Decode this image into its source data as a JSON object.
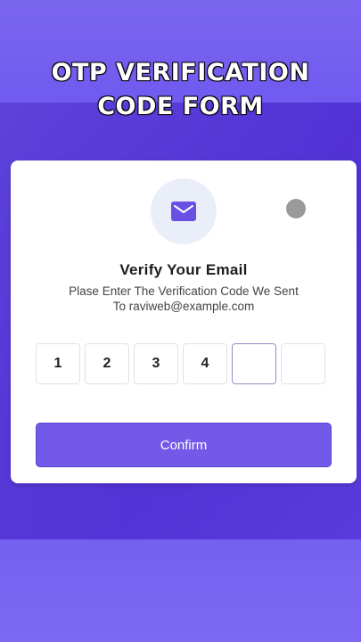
{
  "banner": {
    "line1": "OTP VERIFICATION",
    "line2": "CODE FORM"
  },
  "card": {
    "icon": "mail-icon",
    "title": "Verify Your Email",
    "subtitle_line1": "Plase Enter The Verification Code We Sent",
    "subtitle_line2": "To raviweb@example.com",
    "otp_digits": [
      "1",
      "2",
      "3",
      "4",
      "",
      ""
    ],
    "confirm_label": "Confirm"
  },
  "colors": {
    "accent": "#7359e8",
    "icon_bg": "#e9eef8",
    "background": "#5a3ddc"
  }
}
